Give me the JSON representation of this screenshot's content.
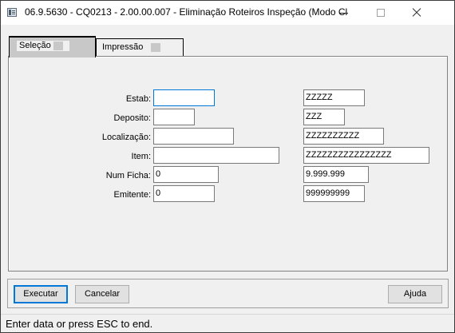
{
  "window": {
    "title": "06.9.5630 - CQ0213 - 2.00.00.007 - Eliminação Roteiros Inspeção (Modo Cl...",
    "icons": {
      "app": "program-window-icon",
      "minimize": "minimize-icon",
      "maximize": "maximize-icon",
      "close": "close-icon"
    }
  },
  "tabs": [
    {
      "label": "Seleção",
      "active": true
    },
    {
      "label": "Impressão",
      "active": false
    }
  ],
  "form": {
    "fields": [
      {
        "label": "Estab:",
        "from": "",
        "to": "ZZZZZ"
      },
      {
        "label": "Deposito:",
        "from": "",
        "to": "ZZZ"
      },
      {
        "label": "Localização:",
        "from": "",
        "to": "ZZZZZZZZZZ"
      },
      {
        "label": "Item:",
        "from": "",
        "to": "ZZZZZZZZZZZZZZZZ"
      },
      {
        "label": "Num Ficha:",
        "from": "0",
        "to": "9.999.999"
      },
      {
        "label": "Emitente:",
        "from": "0",
        "to": "999999999"
      }
    ]
  },
  "buttons": {
    "execute": "Executar",
    "cancel": "Cancelar",
    "help": "Ajuda"
  },
  "status": {
    "text": "Enter data or press ESC to end."
  },
  "colors": {
    "focus_accent": "#0078d7",
    "window_background": "#f0f0f0",
    "active_tab": "#c8c8c8"
  }
}
